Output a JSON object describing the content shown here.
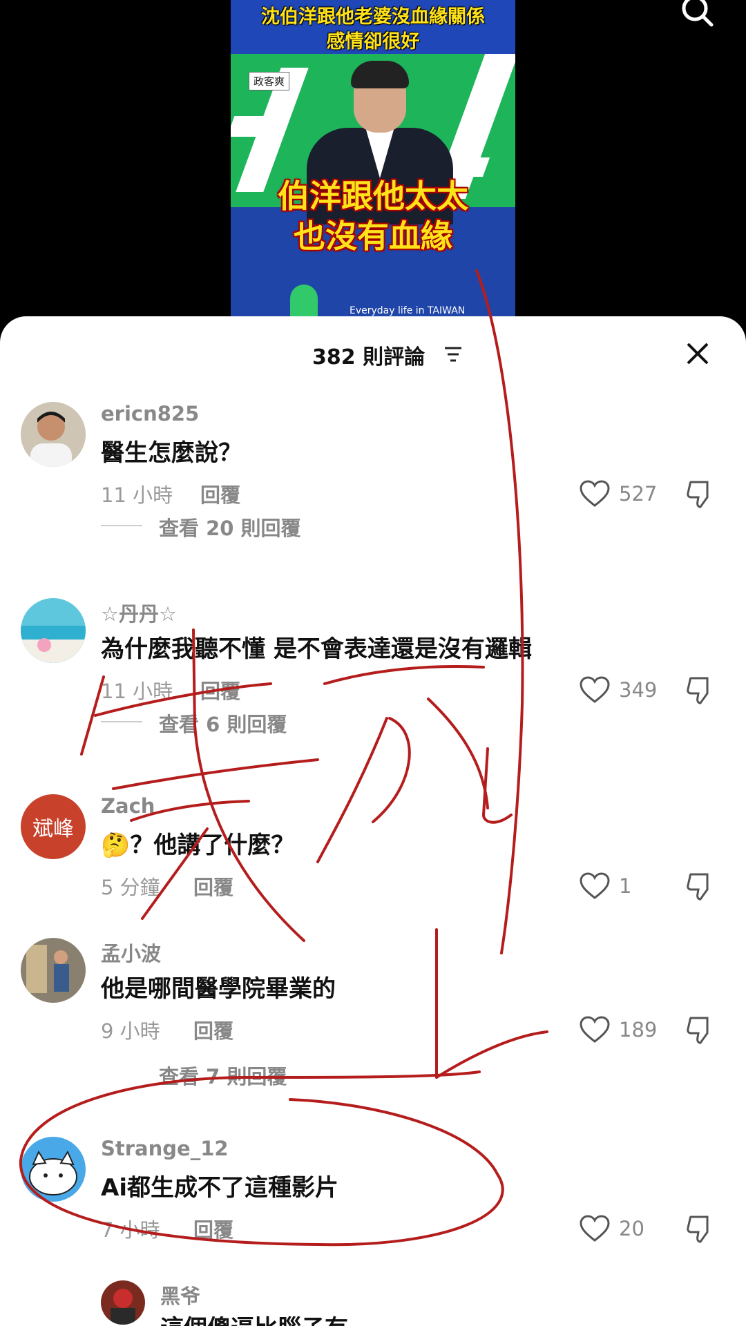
{
  "video": {
    "title_line1": "沈伯洋跟他老婆沒血緣關係",
    "title_line2": "感情卻很好",
    "fb_tag": "政客爽",
    "caption_line1": "伯洋跟他太太",
    "caption_line2": "也沒有血緣",
    "footer": "Everyday life in TAIWAN"
  },
  "header": {
    "count": "382 則評論"
  },
  "comments": [
    {
      "username": "ericn825",
      "text": "醫生怎麼說？",
      "time": "11 小時",
      "reply": "回覆",
      "likes": "527",
      "view_replies": "查看 20 則回覆"
    },
    {
      "username": "☆丹丹☆",
      "text": "為什麼我聽不懂 是不會表達還是沒有邏輯",
      "time": "11 小時",
      "reply": "回覆",
      "likes": "349",
      "view_replies": "查看 6 則回覆"
    },
    {
      "username": "Zach",
      "avatar_text": "斌峰",
      "text": "🤔？他講了什麼？",
      "time": "5 分鐘",
      "reply": "回覆",
      "likes": "1"
    },
    {
      "username": "孟小波",
      "text": "他是哪間醫學院畢業的",
      "time": "9 小時",
      "reply": "回覆",
      "likes": "189",
      "view_replies": "查看 7 則回覆"
    },
    {
      "username": "Strange_12",
      "text": "Ai都生成不了這種影片",
      "time": "7 小時",
      "reply": "回覆",
      "likes": "20"
    },
    {
      "username": "黑爷",
      "text": "這個傻逼比腦子有"
    }
  ],
  "colors": {
    "annotation": "#b51d1d",
    "sheet": "#ffffff",
    "muted": "#888888"
  }
}
